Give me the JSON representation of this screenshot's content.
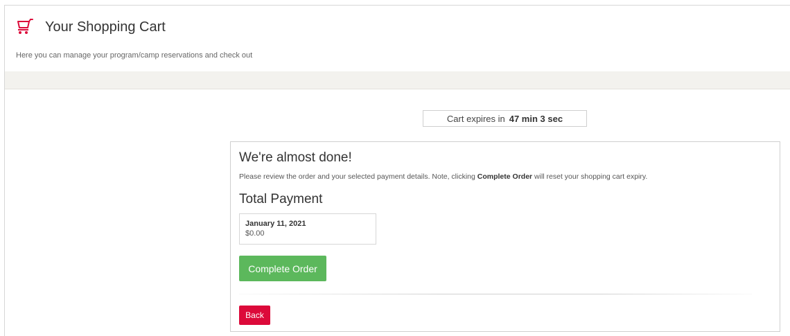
{
  "header": {
    "icon": "shopping-cart-icon",
    "title": "Your Shopping Cart",
    "subtitle": "Here you can manage your program/camp reservations and check out"
  },
  "expiry": {
    "label": "Cart expires in",
    "time": "47 min 3 sec"
  },
  "panel": {
    "heading": "We're almost done!",
    "note_before": "Please review the order and your selected payment details. Note, clicking ",
    "note_bold": "Complete Order",
    "note_after": " will reset your shopping cart expiry.",
    "total_heading": "Total Payment",
    "payment": {
      "date": "January 11, 2021",
      "amount": "$0.00"
    },
    "complete_label": "Complete Order",
    "back_label": "Back"
  },
  "colors": {
    "brand_red": "#dc0a3a",
    "success_green": "#5cb85c",
    "band": "#f3f2ee"
  }
}
